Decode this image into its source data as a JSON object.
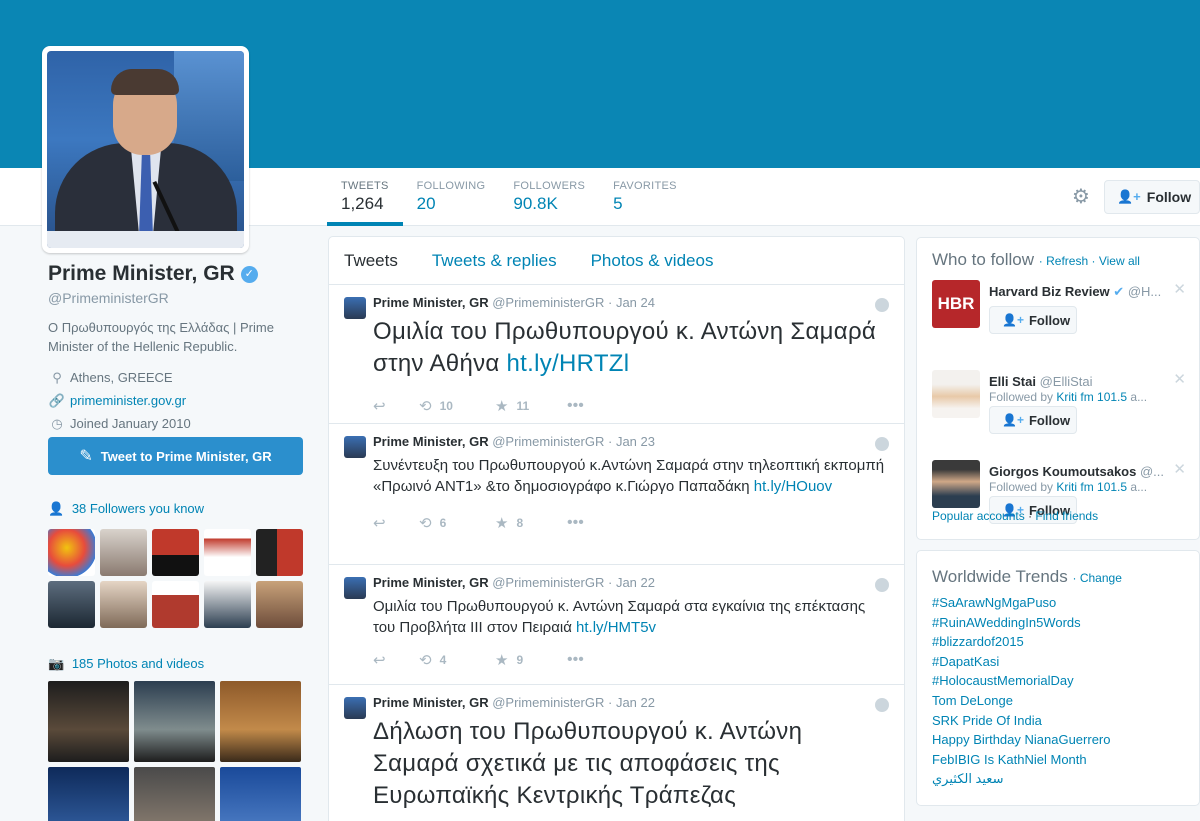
{
  "colors": {
    "banner": "#0a86b4",
    "link": "#0084b4",
    "button": "#2b8fcd",
    "page_bg": "#f5f8fa"
  },
  "profile": {
    "name": "Prime Minister, GR",
    "handle": "@PrimeministerGR",
    "bio": "Ο Πρωθυπουργός της Ελλάδας | Prime Minister of the Hellenic Republic.",
    "location": "Athens, GREECE",
    "website": "primeminister.gov.gr",
    "joined": "Joined January 2010",
    "tweet_to_label": "Tweet to Prime Minister, GR",
    "followers_you_know": "38 Followers you know",
    "photos_videos": "185 Photos and videos"
  },
  "stats": [
    {
      "label": "TWEETS",
      "value": "1,264"
    },
    {
      "label": "FOLLOWING",
      "value": "20"
    },
    {
      "label": "FOLLOWERS",
      "value": "90.8K"
    },
    {
      "label": "FAVORITES",
      "value": "5"
    }
  ],
  "header": {
    "follow_label": "Follow"
  },
  "timeline": {
    "tabs": [
      "Tweets",
      "Tweets & replies",
      "Photos & videos"
    ],
    "tweets": [
      {
        "name": "Prime Minister, GR",
        "handle": "@PrimeministerGR",
        "date": "Jan 24",
        "text": "Ομιλία του Πρωθυπουργού κ. Αντώνη Σαμαρά στην Αθήνα ",
        "link": "ht.ly/HRTZl",
        "retweets": "10",
        "favorites": "11"
      },
      {
        "name": "Prime Minister, GR",
        "handle": "@PrimeministerGR",
        "date": "Jan 23",
        "text": "Συνέντευξη του Πρωθυπουργού κ.Αντώνη Σαμαρά στην τηλεοπτική εκπομπή «Πρωινό ΑΝΤ1» &το δημοσιογράφο κ.Γιώργο Παπαδάκη ",
        "link": "ht.ly/HOuov",
        "retweets": "6",
        "favorites": "8"
      },
      {
        "name": "Prime Minister, GR",
        "handle": "@PrimeministerGR",
        "date": "Jan 22",
        "text": "Ομιλία του Πρωθυπουργού κ. Αντώνη Σαμαρά στα εγκαίνια της επέκτασης του Προβλήτα ΙΙΙ στον Πειραιά ",
        "link": "ht.ly/HMT5v",
        "retweets": "4",
        "favorites": "9"
      },
      {
        "name": "Prime Minister, GR",
        "handle": "@PrimeministerGR",
        "date": "Jan 22",
        "text": "Δήλωση του Πρωθυπουργού κ. Αντώνη Σαμαρά σχετικά με τις αποφάσεις της Ευρωπαϊκής Κεντρικής Τράπεζας",
        "link": "",
        "retweets": "",
        "favorites": ""
      }
    ]
  },
  "who_to_follow": {
    "title": "Who to follow",
    "refresh": "Refresh",
    "view_all": "View all",
    "suggestions": [
      {
        "name": "Harvard Biz Review",
        "handle": "@H...",
        "context_prefix": "",
        "context_link": "",
        "context_suffix": "",
        "button": "Follow",
        "logo": "HBR"
      },
      {
        "name": "Elli Stai",
        "handle": "@ElliStai",
        "context_prefix": "Followed by ",
        "context_link": "Kriti fm 101.5",
        "context_suffix": " a...",
        "button": "Follow",
        "logo": ""
      },
      {
        "name": "Giorgos Koumoutsakos",
        "handle": "@...",
        "context_prefix": "Followed by ",
        "context_link": "Kriti fm 101.5",
        "context_suffix": " a...",
        "button": "Follow",
        "logo": ""
      }
    ],
    "popular_accounts": "Popular accounts",
    "find_friends": "Find friends"
  },
  "trends": {
    "title": "Worldwide Trends",
    "change": "Change",
    "items": [
      "#SaArawNgMgaPuso",
      "#RuinAWeddingIn5Words",
      "#blizzardof2015",
      "#DapatKasi",
      "#HolocaustMemorialDay",
      "Tom DeLonge",
      "SRK Pride Of India",
      "Happy Birthday NianaGuerrero",
      "FebIBIG Is KathNiel Month",
      "سعيد الكثيري"
    ]
  }
}
